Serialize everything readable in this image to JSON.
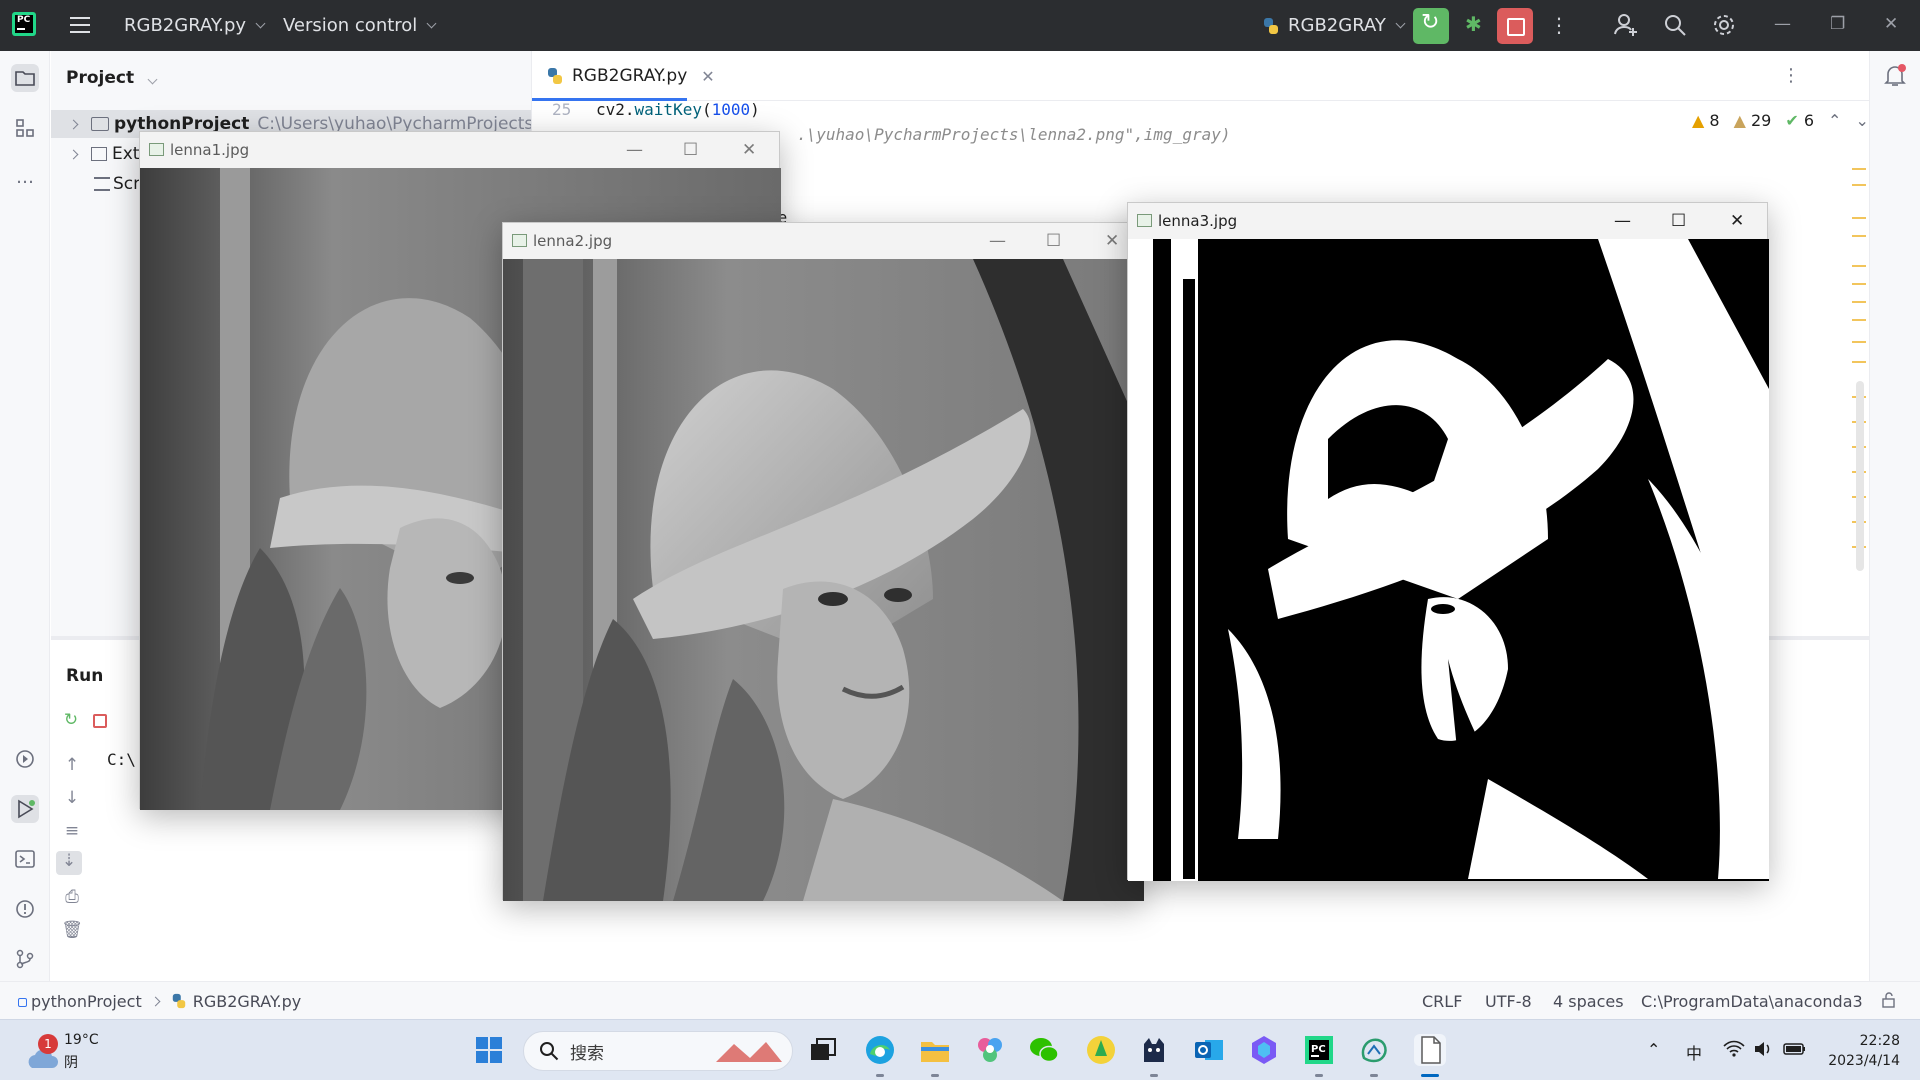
{
  "titlebar": {
    "project_file": "RGB2GRAY.py",
    "vcs_label": "Version control",
    "run_config": "RGB2GRAY",
    "window_controls": [
      "minimize-icon",
      "restore-icon",
      "close-icon"
    ]
  },
  "project_panel": {
    "title": "Project",
    "tree": [
      {
        "label": "pythonProject",
        "path": "C:\\Users\\yuhao\\PycharmProjects\\pyt"
      },
      {
        "label": "Ext"
      },
      {
        "label": "Scr"
      }
    ]
  },
  "editor": {
    "tab_label": "RGB2GRAY.py",
    "line_no": "25",
    "code_line_1": {
      "a": "cv2.",
      "b": "waitKey",
      "c": "(",
      "d": "1000",
      "e": ")"
    },
    "code_line_2": ".\\yuhao\\PycharmProjects\\lenna2.png\",img_gray)",
    "code_fragment": "ne",
    "inspections": {
      "warn_strong": "8",
      "warn_weak": "29",
      "ok": "6"
    }
  },
  "run_panel": {
    "title": "Run",
    "console_text": "C:\\"
  },
  "windows": [
    {
      "title": "lenna1.jpg"
    },
    {
      "title": "lenna2.jpg"
    },
    {
      "title": "lenna3.jpg"
    }
  ],
  "statusbar": {
    "breadcrumb_project": "pythonProject",
    "breadcrumb_file": "RGB2GRAY.py",
    "line_sep": "CRLF",
    "encoding": "UTF-8",
    "indent": "4 spaces",
    "interpreter": "C:\\ProgramData\\anaconda3"
  },
  "taskbar": {
    "weather_temp": "19°C",
    "weather_cond": "阴",
    "weather_badge": "1",
    "search_placeholder": "搜索",
    "ime": "中",
    "time": "22:28",
    "date": "2023/4/14"
  },
  "colors": {
    "accent": "#3574f0",
    "run_green": "#5fb865",
    "stop_red": "#db5c5c",
    "warning": "#e5a000",
    "titlebar_bg": "#2b2d30"
  }
}
